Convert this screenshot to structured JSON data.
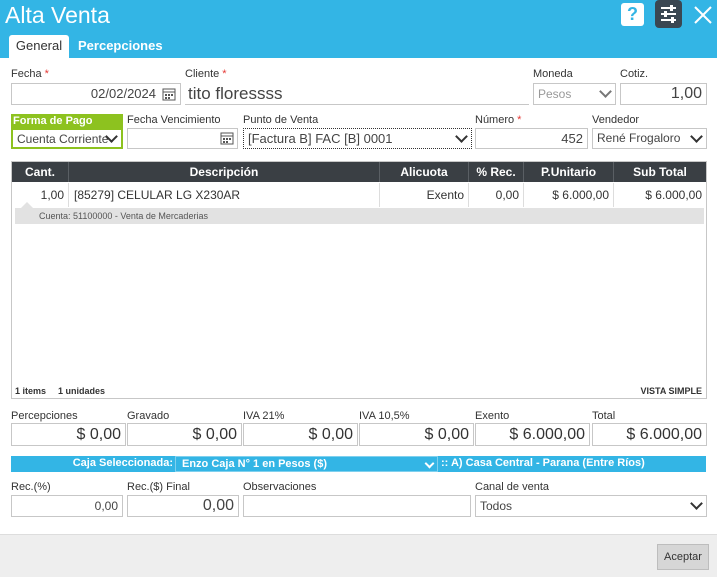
{
  "window": {
    "title": "Alta Venta",
    "help_label": "?"
  },
  "tabs": [
    {
      "label": "General"
    },
    {
      "label": "Percepciones"
    }
  ],
  "form": {
    "fecha": {
      "label": "Fecha",
      "value": "02/02/2024"
    },
    "cliente": {
      "label": "Cliente",
      "value": "tito floressss"
    },
    "moneda": {
      "label": "Moneda",
      "value": "Pesos"
    },
    "cotiz": {
      "label": "Cotiz.",
      "value": "1,00"
    },
    "forma_pago": {
      "label": "Forma de Pago",
      "value": "Cuenta Corriente"
    },
    "fecha_venc": {
      "label": "Fecha Vencimiento",
      "value": ""
    },
    "punto_venta": {
      "label": "Punto de Venta",
      "value": "[Factura B] FAC [B] 0001"
    },
    "numero": {
      "label": "Número",
      "value": "452"
    },
    "vendedor": {
      "label": "Vendedor",
      "value": "René Frogaloro"
    }
  },
  "grid": {
    "headers": {
      "cant": "Cant.",
      "descripcion": "Descripción",
      "alicuota": "Alicuota",
      "rec": "% Rec.",
      "punitario": "P.Unitario",
      "subtotal": "Sub Total"
    },
    "row": {
      "cant": "1,00",
      "descripcion": "[85279] CELULAR LG X230AR",
      "alicuota": "Exento",
      "rec": "0,00",
      "punitario": "$ 6.000,00",
      "subtotal": "$ 6.000,00"
    },
    "subrow": "Cuenta: 51100000 - Venta de Mercaderias",
    "footer_items": "1 items",
    "footer_units": "1 unidades",
    "view_mode": "VISTA SIMPLE"
  },
  "totals": {
    "percepciones": {
      "label": "Percepciones",
      "value": "$ 0,00"
    },
    "gravado": {
      "label": "Gravado",
      "value": "$ 0,00"
    },
    "iva21": {
      "label": "IVA 21%",
      "value": "$ 0,00"
    },
    "iva105": {
      "label": "IVA 10,5%",
      "value": "$ 0,00"
    },
    "exento": {
      "label": "Exento",
      "value": "$ 6.000,00"
    },
    "total": {
      "label": "Total",
      "value": "$ 6.000,00"
    }
  },
  "caja": {
    "label": "Caja Seleccionada:",
    "value": "Enzo Caja N° 1 en Pesos ($)",
    "branch": ":: A) Casa Central - Parana (Entre Ríos)"
  },
  "bottom": {
    "rec_pct": {
      "label": "Rec.(%)",
      "value": "0,00"
    },
    "rec_final": {
      "label": "Rec.($) Final",
      "value": "0,00"
    },
    "observaciones": {
      "label": "Observaciones",
      "value": ""
    },
    "canal": {
      "label": "Canal de venta",
      "value": "Todos"
    }
  },
  "actions": {
    "accept_label": "Aceptar"
  },
  "colors": {
    "accent": "#33b5e5",
    "header_dark": "#3a3f44",
    "forma_pago_green": "#8dc21f"
  }
}
